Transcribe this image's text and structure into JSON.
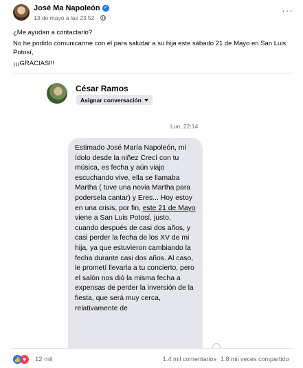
{
  "post": {
    "author": "José Ma Napoleón",
    "timestamp": "13 de mayo a las 23:52",
    "separator": "·",
    "privacy_icon": "globe-icon",
    "body_line1": "¿Me ayudan a contactarlo?",
    "body_line2": "No he podido comunicarme con él para saludar a su hija este sábado 21 de Mayo en San Luis",
    "body_line3": "Potosí,",
    "body_line4": "¡¡¡GRACIAS!!!"
  },
  "screenshot": {
    "contact_name": "César Ramos",
    "assign_label": "Asignar conversación",
    "message_time": "Lun, 22:14",
    "message_before": "Estimado José María Napoleón, mi ídolo desde la niñez Crecí con tu música, es fecha y aún viajo escuchando vive, ella se llamaba Martha ( tuve una novia Martha para podersela cantar) y Eres... Hoy estoy en una crisis, por fin,",
    "message_underlined": "este 21 de Mayo",
    "message_after": "viene a San Luis Potosí,  justo, cuando después de casi dos años, y casi perder la fecha de los XV de mi hija, ya que estuvieron cambiando la fecha durante casi dos años. Al caso, le prometí llevarla a tu concierto, pero el salón nos dió la misma fecha a expensas de perder la inversión de la fiesta, que será muy cerca, relativamente de"
  },
  "footer": {
    "reactions_count": "12 mil",
    "comments": "1.4 mil comentarios",
    "shares": "1.8 mil veces compartido"
  },
  "colors": {
    "accent": "#1877f2",
    "love": "#f33e58",
    "secondary_text": "#65676b",
    "bubble": "#e4e6eb"
  }
}
